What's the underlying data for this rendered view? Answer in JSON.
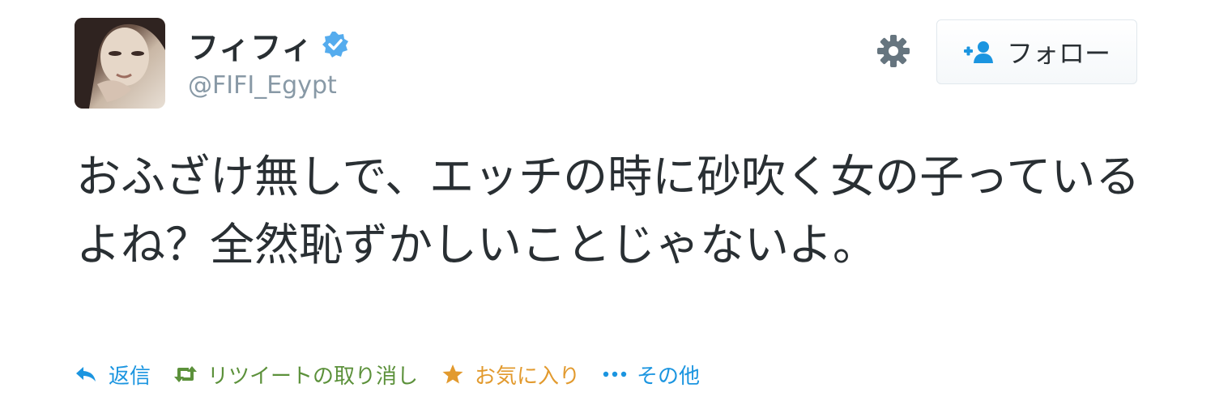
{
  "user": {
    "display_name": "フィフィ",
    "handle": "@FIFI_Egypt",
    "verified": true
  },
  "follow_button": {
    "label": "フォロー",
    "icon": "add-user-icon"
  },
  "settings_icon": "gear-icon",
  "tweet": {
    "text": "おふざけ無しで、エッチの時に砂吹く女の子っているよね？全然恥ずかしいことじゃないよ。"
  },
  "actions": [
    {
      "label": "返信",
      "icon": "reply-icon",
      "color": "#1b95e0"
    },
    {
      "label": "リツイートの取り消し",
      "icon": "retweet-icon",
      "color": "#5c913b"
    },
    {
      "label": "お気に入り",
      "icon": "star-icon",
      "color": "#e29a2e"
    },
    {
      "label": "その他",
      "icon": "more-icon",
      "color": "#1b95e0"
    }
  ],
  "colors": {
    "link_blue": "#1b95e0",
    "retweet_green": "#5c913b",
    "favorite_orange": "#e29a2e",
    "text_primary": "#292f33",
    "text_secondary": "#8899a6"
  }
}
